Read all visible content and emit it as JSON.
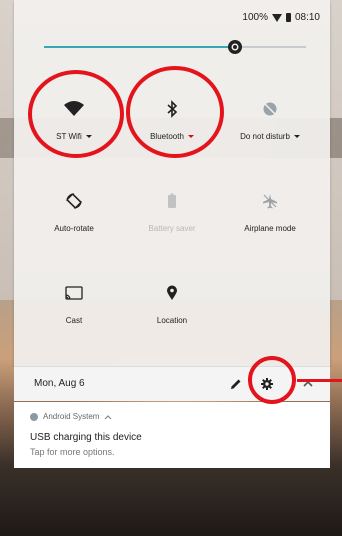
{
  "status_bar": {
    "battery_percent": "100%",
    "time": "08:10"
  },
  "brightness": {
    "level": 0.73
  },
  "tiles": [
    {
      "name": "wifi",
      "label": "ST Wifi",
      "icon": "wifi-icon",
      "has_dropdown": true,
      "disabled": false
    },
    {
      "name": "bluetooth",
      "label": "Bluetooth",
      "icon": "bluetooth-icon",
      "has_dropdown": true,
      "disabled": false
    },
    {
      "name": "do-not-disturb",
      "label": "Do not disturb",
      "icon": "do-not-disturb-icon",
      "has_dropdown": true,
      "disabled": false
    },
    {
      "name": "auto-rotate",
      "label": "Auto-rotate",
      "icon": "auto-rotate-icon",
      "has_dropdown": false,
      "disabled": false
    },
    {
      "name": "battery-saver",
      "label": "Battery saver",
      "icon": "battery-saver-icon",
      "has_dropdown": false,
      "disabled": true
    },
    {
      "name": "airplane-mode",
      "label": "Airplane mode",
      "icon": "airplane-icon",
      "has_dropdown": false,
      "disabled": false
    },
    {
      "name": "cast",
      "label": "Cast",
      "icon": "cast-icon",
      "has_dropdown": false,
      "disabled": false
    },
    {
      "name": "location",
      "label": "Location",
      "icon": "location-icon",
      "has_dropdown": false,
      "disabled": false
    }
  ],
  "date_bar": {
    "date": "Mon, Aug 6"
  },
  "notification": {
    "app_name": "Android System",
    "title": "USB charging this device",
    "body": "Tap for more options."
  },
  "colors": {
    "accent": "#37a7b5",
    "annotation": "#e3141c",
    "panel": "#f2f0ee"
  }
}
